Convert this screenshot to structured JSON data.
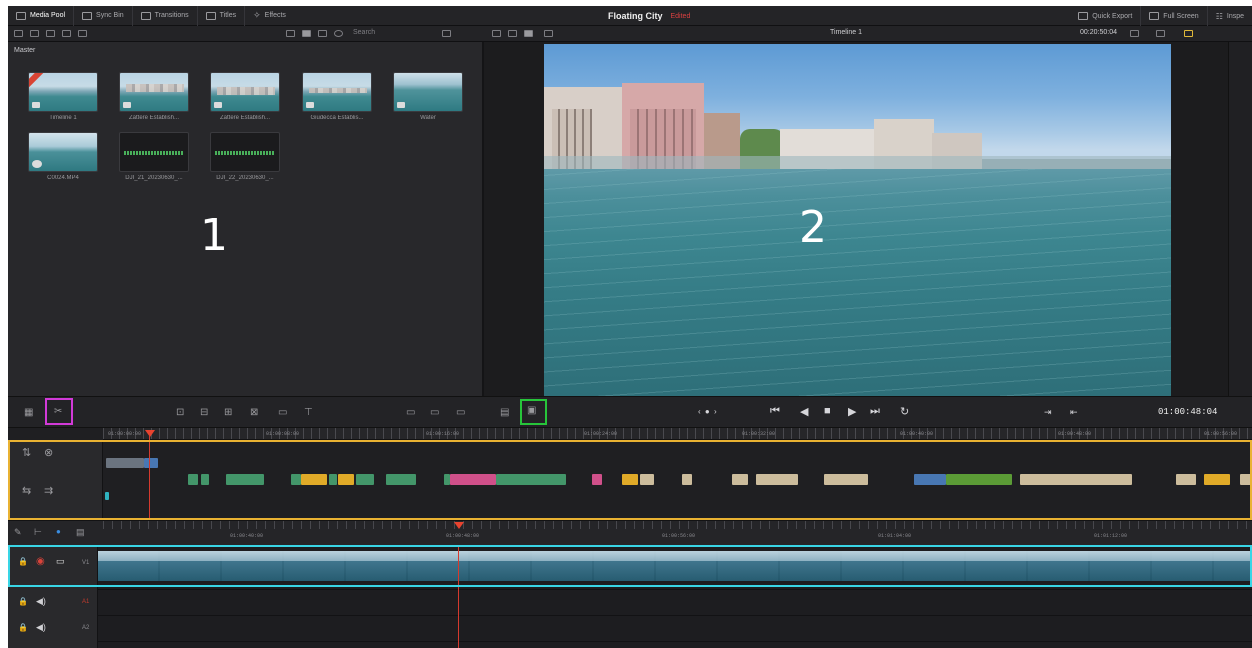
{
  "topbar": {
    "media_pool": "Media Pool",
    "sync_bin": "Sync Bin",
    "transitions": "Transitions",
    "titles": "Titles",
    "effects": "Effects",
    "project_title": "Floating City",
    "project_status": "Edited",
    "quick_export": "Quick Export",
    "full_screen": "Full Screen",
    "inspector": "Inspe"
  },
  "bar2": {
    "search": "Search",
    "timeline_name": "Timeline 1",
    "timecode": "00:20:50:04"
  },
  "media_pool": {
    "bin_name": "Master",
    "clips": [
      {
        "name": "Timeline 1",
        "kind": "timeline"
      },
      {
        "name": "Zattere Establish...",
        "kind": "video"
      },
      {
        "name": "Zattere Establish...",
        "kind": "video"
      },
      {
        "name": "Giudecca Establis...",
        "kind": "video"
      },
      {
        "name": "Water",
        "kind": "video"
      },
      {
        "name": "C0024.MP4",
        "kind": "video"
      },
      {
        "name": "DJI_21_20230630_...",
        "kind": "audio"
      },
      {
        "name": "DJI_22_20230630_...",
        "kind": "audio"
      }
    ],
    "annotation": "1"
  },
  "viewer": {
    "annotation": "2"
  },
  "transport": {
    "timecode": "01:00:48:04"
  },
  "upper_timeline": {
    "timecodes": [
      "01:00:00:00",
      "01:00:08:00",
      "01:00:16:00",
      "01:00:24:00",
      "01:00:32:00",
      "01:00:40:00",
      "01:00:48:00",
      "01:00:56:00",
      "01:01:04:00",
      "01:01:12:00",
      "01:01:20:00"
    ]
  },
  "lower_timeline": {
    "timecodes": [
      "01:00:40:00",
      "01:00:48:00",
      "01:00:56:00",
      "01:01:04:00",
      "01:01:12:00"
    ],
    "tracks": [
      "V1",
      "A1",
      "A2"
    ]
  },
  "colors": {
    "annotation_magenta": "#d23ad8",
    "annotation_green": "#27c53a",
    "annotation_orange": "#e9b232",
    "annotation_cyan": "#39d6e6",
    "playhead": "#e8432f"
  }
}
